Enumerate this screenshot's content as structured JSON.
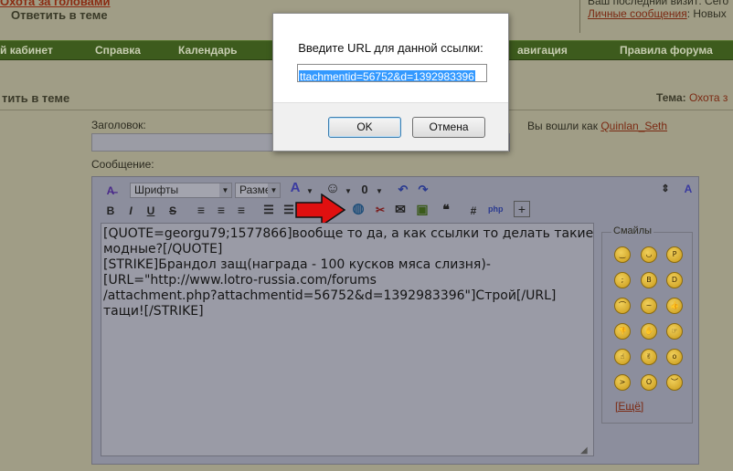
{
  "header": {
    "forum_link": "Охота за головами",
    "reply_heading": "Ответить в теме",
    "last_visit": "Ваш последний визит: Сего",
    "private_messages": "Личные сообщения",
    "new_label": ": Новых"
  },
  "nav": {
    "items": [
      "й кабинет",
      "Справка",
      "Календарь",
      "авигация",
      "Правила форума"
    ]
  },
  "section": {
    "reply": "тить в теме",
    "theme_label": "Тема:",
    "theme_value": "Охота з"
  },
  "form": {
    "title_label": "Заголовок:",
    "logged_in_prefix": "Вы вошли как",
    "username": "Quinlan_Seth",
    "message_label": "Сообщение:"
  },
  "toolbar": {
    "font_select": "Шрифты",
    "size_select": "Разме",
    "bold": "B",
    "italic": "I",
    "underline": "U",
    "strike": "S",
    "hash": "#"
  },
  "message": {
    "lines": [
      "[QUOTE=georgu79;1577866]вообще то да, а как ссылки то делать такие",
      "модные?[/QUOTE]",
      "",
      "[STRIKE]Брандол защ(награда - 100 кусков мяса слизня)-",
      "[URL=\"http://www.lotro-russia.com/forums",
      "/attachment.php?attachmentid=56752&d=1392983396\"]Строй[/URL]",
      "тащи![/STRIKE]"
    ]
  },
  "smilies": {
    "legend": "Смайлы",
    "more": "[Ещё]",
    "items": [
      "smile-icon",
      "biggrin-icon",
      "tongue-icon",
      "wink-icon",
      "cool-icon",
      "laugh-icon",
      "frown-icon",
      "confused-icon",
      "thumbsup-icon",
      "thumbsdown-icon",
      "stop-icon",
      "point-icon",
      "victory-icon",
      "peace-icon",
      "rolleyes-icon",
      "angry-icon",
      "eek-icon",
      "sad-icon"
    ]
  },
  "dialog": {
    "prompt": "Введите URL для данной ссылки:",
    "url_value": "ttachmentid=56752&d=1392983396",
    "ok_label": "OK",
    "cancel_label": "Отмена"
  },
  "colors": {
    "nav_bg": "#3d5b1d",
    "link": "#7b2a13",
    "arrow": "#e01010",
    "selection": "#3399ff"
  }
}
